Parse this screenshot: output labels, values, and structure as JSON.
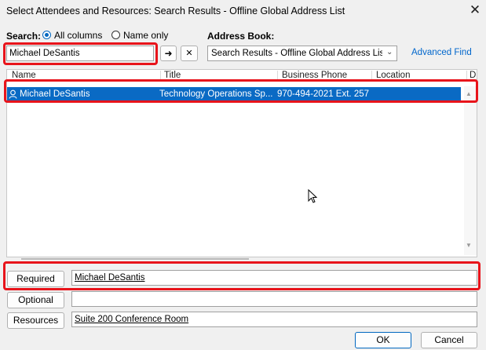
{
  "window": {
    "title": "Select Attendees and Resources: Search Results - Offline Global Address List",
    "close_glyph": "✕"
  },
  "search": {
    "label": "Search:",
    "option_all": "All columns",
    "option_name": "Name only",
    "selected": "All columns",
    "value": "Michael DeSantis",
    "go_glyph": "➜",
    "clear_glyph": "✕"
  },
  "address_book": {
    "label": "Address Book:",
    "value": "Search Results - Offline Global Address Lis",
    "advanced_find": "Advanced Find"
  },
  "table": {
    "columns": [
      "Name",
      "Title",
      "Business Phone",
      "Location",
      "D"
    ],
    "rows": [
      {
        "name": "Michael DeSantis",
        "title": "Technology Operations Sp...",
        "phone": "970-494-2021 Ext. 257",
        "location": "",
        "selected": true
      }
    ]
  },
  "fields": {
    "required_label": "Required",
    "required_value": "Michael DeSantis",
    "optional_label": "Optional",
    "optional_value": "",
    "resources_label": "Resources",
    "resources_value": "Suite 200 Conference Room"
  },
  "buttons": {
    "ok": "OK",
    "cancel": "Cancel"
  },
  "colors": {
    "selection": "#0a6ac4",
    "highlight": "#e8141b",
    "link": "#0066cc"
  }
}
